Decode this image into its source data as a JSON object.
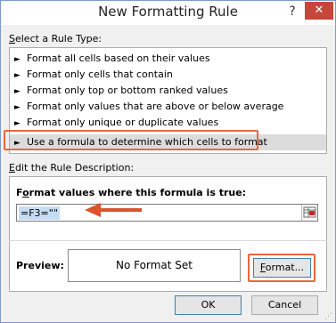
{
  "window": {
    "title": "New Formatting Rule",
    "help_symbol": "?",
    "close_symbol": "✕"
  },
  "rule_type": {
    "heading_prefix": "",
    "heading_key": "S",
    "heading_rest": "elect a Rule Type:",
    "items": [
      {
        "label": "Format all cells based on their values"
      },
      {
        "label": "Format only cells that contain"
      },
      {
        "label": "Format only top or bottom ranked values"
      },
      {
        "label": "Format only values that are above or below average"
      },
      {
        "label": "Format only unique or duplicate values"
      },
      {
        "label": "Use a formula to determine which cells to format",
        "selected": true
      }
    ]
  },
  "description": {
    "heading_key": "E",
    "heading_rest": "dit the Rule Description:",
    "formula_label_pre": "F",
    "formula_label_key": "o",
    "formula_label_rest": "rmat values where this formula is true:",
    "formula_value": "=F3=\"\""
  },
  "preview": {
    "label": "Preview:",
    "text": "No Format Set"
  },
  "buttons": {
    "format_key": "F",
    "format_rest": "ormat...",
    "ok": "OK",
    "cancel": "Cancel"
  },
  "colors": {
    "highlight": "#e8683a",
    "title_bar": "#ffffff",
    "close_button": "#c7463b"
  },
  "icons": {
    "rule_bullet": "arrow-right-icon",
    "range_selector": "collapse-dialog-icon",
    "annotation": "red-arrow-icon"
  }
}
